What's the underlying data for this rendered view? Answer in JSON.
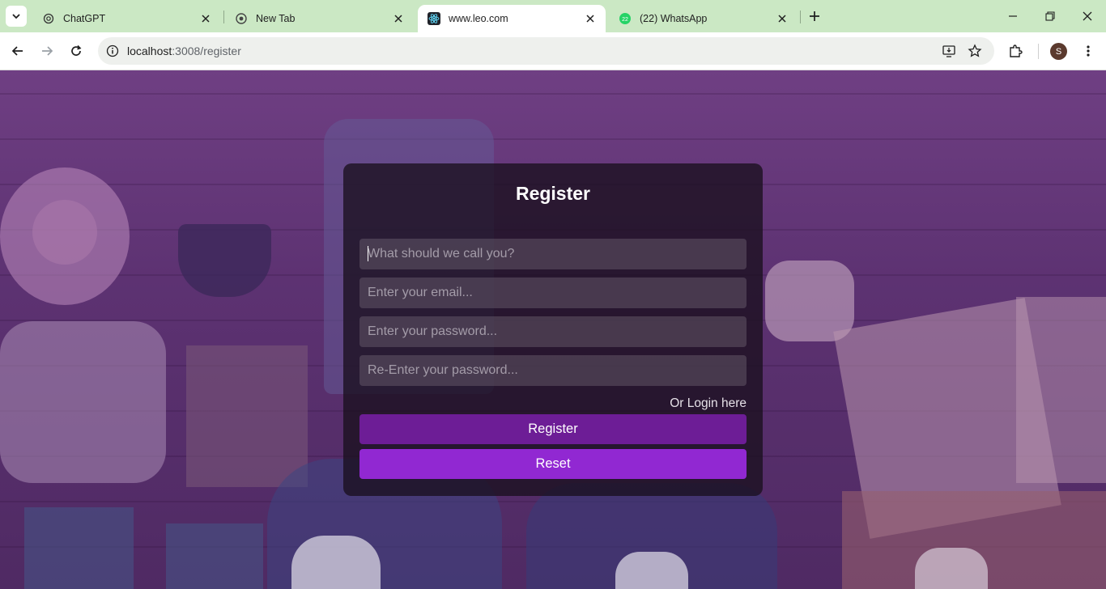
{
  "browser": {
    "tabs": [
      {
        "title": "ChatGPT",
        "icon": "openai-icon",
        "active": false
      },
      {
        "title": "New Tab",
        "icon": "chrome-icon",
        "active": false
      },
      {
        "title": "www.leo.com",
        "icon": "react-icon",
        "active": true
      },
      {
        "title": "(22) WhatsApp",
        "icon": "whatsapp-icon",
        "badge": "22",
        "active": false
      }
    ],
    "address": {
      "host": "localhost",
      "path": ":3008/register"
    },
    "profile_initial": "S"
  },
  "colors": {
    "tabstrip": "#cbe8c4",
    "register_button": "#6d1d96",
    "reset_button": "#9128d2",
    "card_background": "rgba(25,15,30,0.78)"
  },
  "register_form": {
    "title": "Register",
    "fields": {
      "name_placeholder": "What should we call you?",
      "email_placeholder": "Enter your email...",
      "password_placeholder": "Enter your password...",
      "confirm_password_placeholder": "Re-Enter your password..."
    },
    "login_link": "Or Login here",
    "register_label": "Register",
    "reset_label": "Reset"
  }
}
